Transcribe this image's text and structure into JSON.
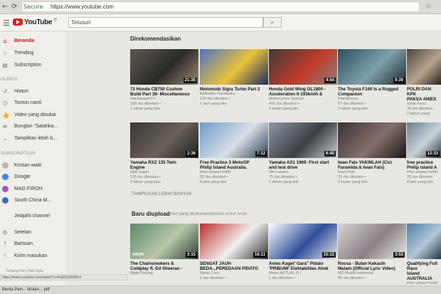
{
  "browser": {
    "secure_label": "Secure",
    "url": "https://www.youtube.com"
  },
  "header": {
    "logo_text": "YouTube",
    "logo_sup": "ID",
    "search_value": "Telusuri"
  },
  "sidebar": {
    "main_items": [
      {
        "label": "Beranda",
        "icon": "home-icon"
      },
      {
        "label": "Trending",
        "icon": "flame-icon"
      },
      {
        "label": "Subscription",
        "icon": "subscription-icon"
      }
    ],
    "library_header": "OLEKSI",
    "library_items": [
      {
        "label": "Histori",
        "icon": "history-icon"
      },
      {
        "label": "Tonton nanti",
        "icon": "clock-icon"
      },
      {
        "label": "Video yang disukai",
        "icon": "thumbs-up-icon"
      },
      {
        "label": "Bunglon \"Salahka...",
        "icon": "playlist-icon"
      },
      {
        "label": "Tampilkan lebih b...",
        "icon": "chevron-down-icon"
      }
    ],
    "subscription_header": "SUBSCRIPTION",
    "channels": [
      {
        "label": "Kristan waitt",
        "color": "#b9b7b1"
      },
      {
        "label": "Google",
        "color": "#4285f4"
      },
      {
        "label": "MAG FIROH",
        "color": "#a05bc4"
      },
      {
        "label": "South China M...",
        "color": "#3a6fb5"
      }
    ],
    "browse_channels": "Jelajahi channel",
    "bottom_items": [
      {
        "label": "Setelan",
        "icon": "gear-icon"
      },
      {
        "label": "Bantuan",
        "icon": "help-icon"
      },
      {
        "label": "Kirim masukan",
        "icon": "feedback-icon"
      }
    ],
    "footer_links": "Tentang  Pers  Hak Cipta"
  },
  "sections": {
    "recommended_title": "Direkomendasikan",
    "show_more": "TAMPILKAN LEBIH BANYAK",
    "uploads_title": "Baru diupload",
    "uploads_subtitle": "Video yang direkomendasikan untuk Anda"
  },
  "row1": [
    {
      "title": "73 Honda CB750 Custom\nBuild Part 39- Miscellaneous",
      "meta": "HackawaskTV\n189 rbx ditonton •\n1 tahun yang lalu",
      "duration": "21:35",
      "colors": [
        "#5f5a50",
        "#2b2a28",
        "#9b8e74"
      ]
    },
    {
      "title": "Motomobi Sigra Turbo Part 2",
      "meta": "Bathathu Sahabatku\n134 rbx ditonton •\n1 hari yang lalu",
      "duration": "",
      "colors": [
        "#4f73c4",
        "#e8c23a",
        "#1f2b60"
      ]
    },
    {
      "title": "Honda Gold Wing GL1800 -\nAcceleration 0-193km/h &",
      "meta": "Motorcycles Special\n490 rbx ditonton •\n4 bulan yang lalu",
      "duration": "4:54",
      "colors": [
        "#3e3a36",
        "#c23a2a",
        "#8a8076"
      ]
    },
    {
      "title": "The Toyota FJ40 Is a Rugged\nCompanion",
      "meta": "Petrolicious\n97 rbx ditonton •\n2 tahun yang lalu",
      "duration": "9:39",
      "colors": [
        "#2f4f62",
        "#7fa0aa",
        "#1d2a30"
      ]
    },
    {
      "title": "POLRI DAN KPK\nPAKSA ANIES",
      "meta": "Seda Ferul\n33 rbx ditonton\n2 tahun yang",
      "duration": "",
      "colors": [
        "#4a4440",
        "#b9a38c",
        "#2a2522"
      ]
    }
  ],
  "row2": [
    {
      "title": "Yamaha RXZ 135 Twin\nEngine",
      "meta": "Zaki Super\n115 rbx ditonton •\n2 tahun yang lalu",
      "duration": "2:36",
      "colors": [
        "#3a3632",
        "#6a625a",
        "#1f1c1a"
      ]
    },
    {
      "title": "Free Practice 3 MotoGP\nPhilip Island Australia.",
      "meta": "irfan urbaun hofid\n20 rbx ditonton •\n8 jam yang lalu",
      "duration": "7:12",
      "colors": [
        "#6d9cc8",
        "#d9dfe6",
        "#2f3e55"
      ]
    },
    {
      "title": "Yamaha AS1 1969: First start\nand test drive",
      "meta": "Ole Larsen\n75 rbx ditonton •\n3 tahun yang lalu",
      "duration": "6:40",
      "colors": [
        "#8d98a2",
        "#3b3f44",
        "#c9ccd0"
      ]
    },
    {
      "title": "Iwan Fals YAKINLAH (Cici\nFaramida & Iwan Fals)",
      "meta": "Iwan Fals\n21 rbx ditonton •\n2 bulan yang lalu",
      "duration": "",
      "colors": [
        "#3b2f36",
        "#85706c",
        "#1a1517"
      ]
    },
    {
      "title": "free practice\nPhilip island A",
      "meta": "irfan urbaun hofid\n20 rbx ditonton\n8 jam yang lalu",
      "duration": "12:33",
      "colors": [
        "#6a7f8c",
        "#c8d2d8",
        "#2b3a44"
      ]
    }
  ],
  "row3": [
    {
      "title": "The Chainsmokers &\nColdplay ft. Ed Sheeran -",
      "meta": "MgkeTrstung\n",
      "duration": "3:15",
      "badge": "vevo",
      "colors": [
        "#5d8a6a",
        "#b8c7a8",
        "#2c3f33"
      ]
    },
    {
      "title": "SENGAT JAUH\nBEDA...PEREDAAN PIDATO",
      "meta": "News Cont\n1 rbx ditonton •",
      "duration": "16:11",
      "colors": [
        "#c0302a",
        "#f0f0f0",
        "#2c2c2c"
      ]
    },
    {
      "title": "Anies Kaget' Gara\" Pidato\n'PRIBUMI' Elektabilitas Ahok",
      "meta": "Metro AKTUAL R.I.\n1 rbx ditonton •",
      "duration": "15:12",
      "colors": [
        "#ffffff",
        "#2d4d9a",
        "#e8e8e8"
      ]
    },
    {
      "title": "Rossa - Bulan Kekasih\nMalam (Official Lyric Video)",
      "meta": "MD Musik Indonesia\n50 rbx ditonton •",
      "duration": "3:53",
      "colors": [
        "#d8d4d6",
        "#8a7f86",
        "#eceaeb"
      ]
    },
    {
      "title": "Qualifying Full Race\nIsland AUSTRALIA",
      "meta": "irfan urbaun hofid\n1 rbx ditonton",
      "duration": "",
      "colors": [
        "#4e7fa6",
        "#b3c7d6",
        "#22384a"
      ]
    }
  ],
  "status_url": "https://www.youtube.com/watch?v=5s6RQ2KBfU4",
  "download_item": "Berita Pers - Wulan....pdf"
}
